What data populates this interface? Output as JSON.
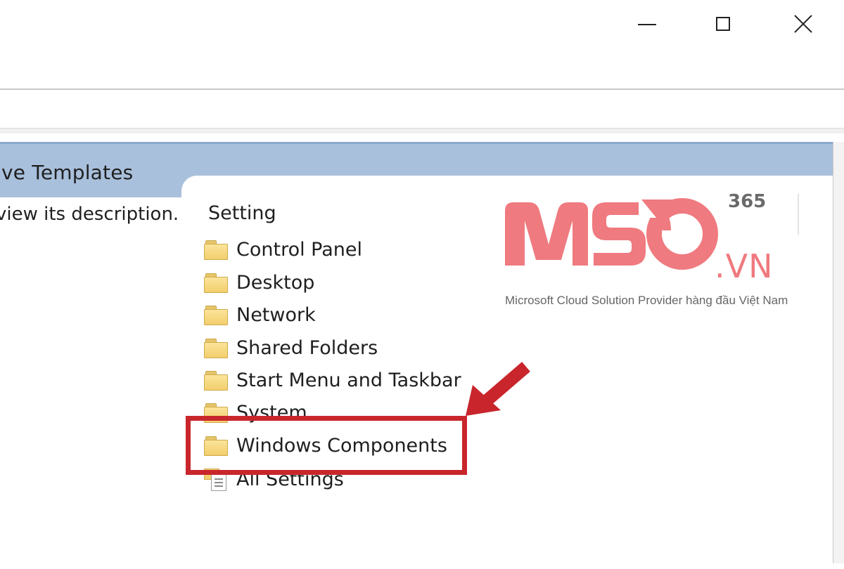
{
  "window": {
    "minimize_icon": "minimize-icon",
    "maximize_icon": "maximize-icon",
    "close_icon": "close-icon"
  },
  "pane": {
    "header_title": "ive Templates",
    "left_description": "view its description.",
    "column_header": "Setting",
    "items": [
      {
        "label": "Control Panel",
        "icon": "folder-icon"
      },
      {
        "label": "Desktop",
        "icon": "folder-icon"
      },
      {
        "label": "Network",
        "icon": "folder-icon"
      },
      {
        "label": "Shared Folders",
        "icon": "folder-icon"
      },
      {
        "label": "Start Menu and Taskbar",
        "icon": "folder-icon"
      },
      {
        "label": "System",
        "icon": "folder-icon"
      },
      {
        "label": "Windows Components",
        "icon": "folder-icon"
      },
      {
        "label": "All Settings",
        "icon": "settings-list-icon"
      }
    ]
  },
  "annotation": {
    "highlight_color": "#c8262c",
    "highlighted_item": "Windows Components"
  },
  "watermark": {
    "brand": "MSO",
    "suffix": ".VN",
    "badge": "365",
    "tagline": "Microsoft Cloud Solution Provider hàng đầu Việt Nam",
    "brand_color": "#ef7a7f"
  }
}
